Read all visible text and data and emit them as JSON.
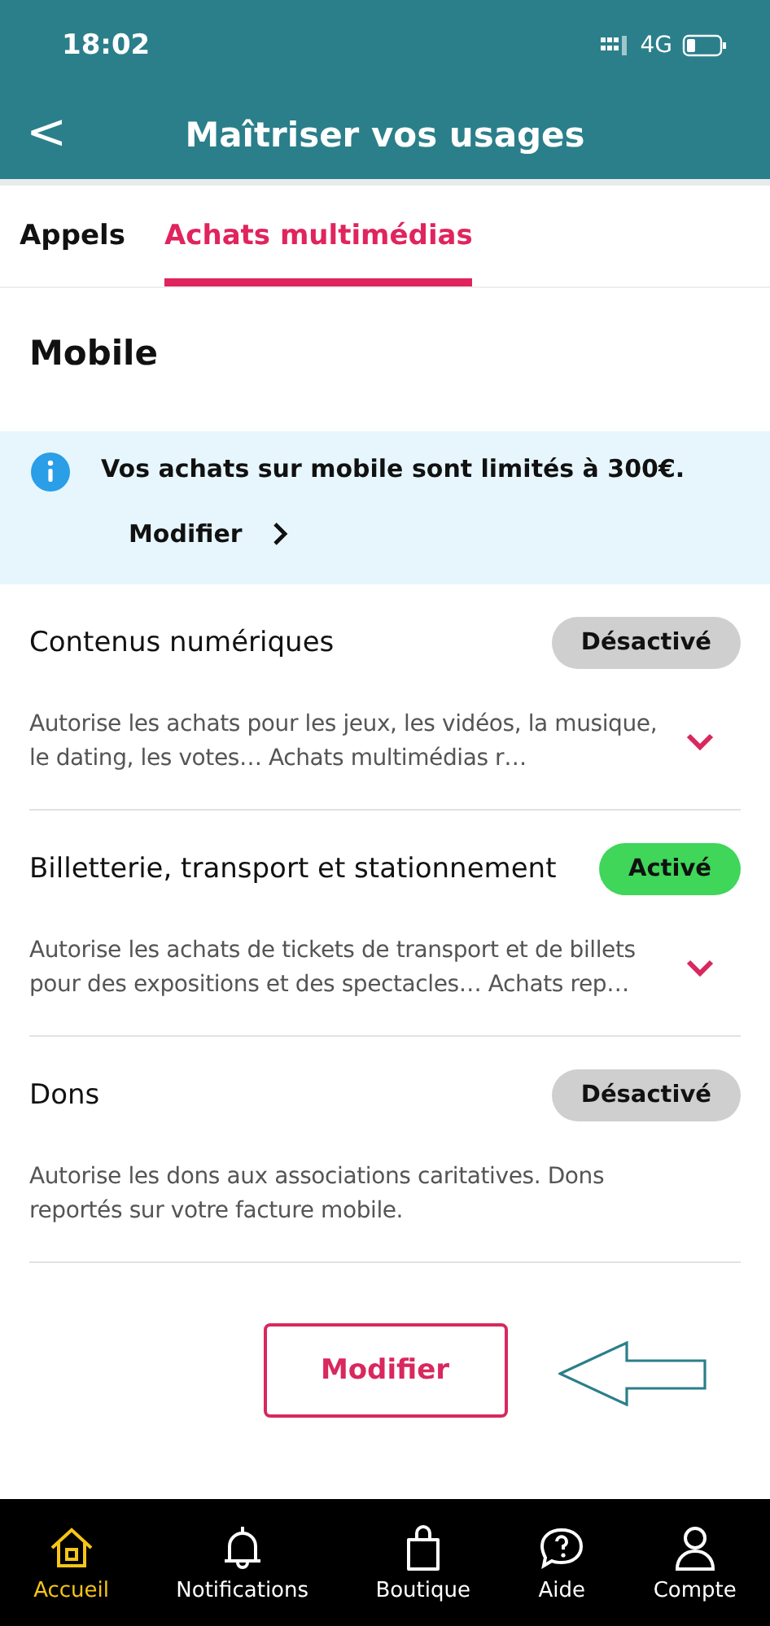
{
  "status_bar": {
    "time": "18:02",
    "network": "4G"
  },
  "header": {
    "title": "Maîtriser vos usages",
    "back": "<"
  },
  "tabs": [
    {
      "label": "Appels",
      "selected": false
    },
    {
      "label": "Achats multimédias",
      "selected": true
    }
  ],
  "section_title": "Mobile",
  "info": {
    "message": "Vos achats sur mobile sont limités à 300€.",
    "link": "Modifier"
  },
  "options": [
    {
      "title": "Contenus numériques",
      "status": "Désactivé",
      "on": false,
      "description": "Autorise les achats pour les jeux, les vidéos, la musique, le dating, les votes… Achats multimédias r…",
      "expandable": true
    },
    {
      "title": "Billetterie, transport et stationnement",
      "status": "Activé",
      "on": true,
      "description": "Autorise les achats de tickets de transport et de billets pour des expositions et des spectacles… Achats rep…",
      "expandable": true
    },
    {
      "title": "Dons",
      "status": "Désactivé",
      "on": false,
      "description": "Autorise les dons aux associations caritatives. Dons reportés sur votre facture mobile.",
      "expandable": false
    }
  ],
  "button": "Modifier",
  "annotation": {
    "kind": "arrow"
  },
  "nav": [
    {
      "label": "Accueil",
      "kind": "home",
      "selected": true
    },
    {
      "label": "Notifications",
      "kind": "bell",
      "selected": false
    },
    {
      "label": "Boutique",
      "kind": "bag",
      "selected": false
    },
    {
      "label": "Aide",
      "kind": "help",
      "selected": false
    },
    {
      "label": "Compte",
      "kind": "user",
      "selected": false
    }
  ]
}
